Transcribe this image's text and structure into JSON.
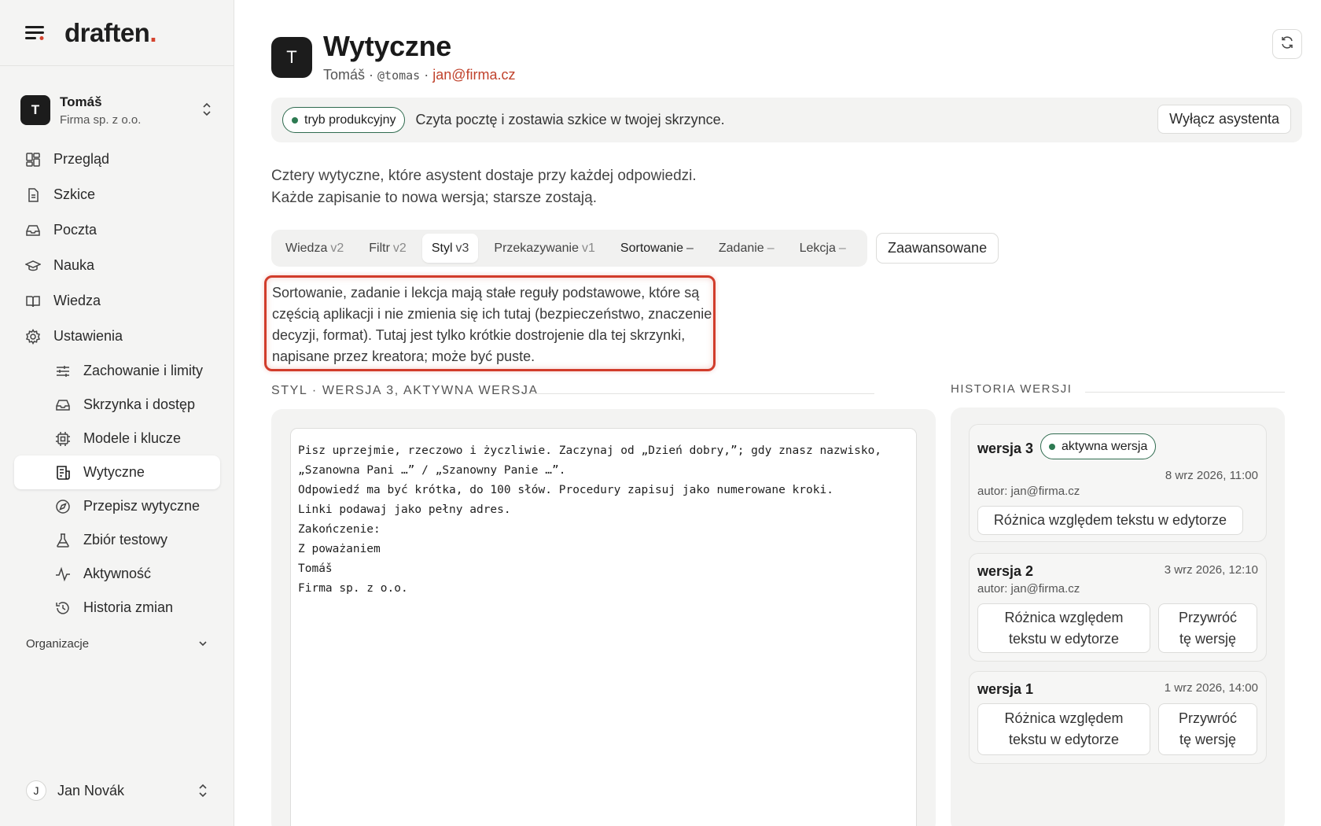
{
  "brand": {
    "logo_text": "draften",
    "logo_dot": "."
  },
  "account": {
    "initial": "T",
    "name": "Tomáš",
    "company": "Firma sp. z o.o."
  },
  "nav": {
    "items": [
      {
        "label": "Przegląd",
        "icon": "dashboard-icon"
      },
      {
        "label": "Szkice",
        "icon": "document-icon"
      },
      {
        "label": "Poczta",
        "icon": "inbox-icon"
      },
      {
        "label": "Nauka",
        "icon": "graduation-cap-icon"
      },
      {
        "label": "Wiedza",
        "icon": "book-icon"
      },
      {
        "label": "Ustawienia",
        "icon": "gear-icon"
      }
    ],
    "sub_items": [
      {
        "label": "Zachowanie i limity",
        "icon": "sliders-icon"
      },
      {
        "label": "Skrzynka i dostęp",
        "icon": "inbox-icon"
      },
      {
        "label": "Modele i klucze",
        "icon": "chip-icon"
      },
      {
        "label": "Wytyczne",
        "icon": "guidelines-icon",
        "active": true
      },
      {
        "label": "Przepisz wytyczne",
        "icon": "compass-icon"
      },
      {
        "label": "Zbiór testowy",
        "icon": "flask-icon"
      },
      {
        "label": "Aktywność",
        "icon": "activity-icon"
      },
      {
        "label": "Historia zmian",
        "icon": "history-icon"
      }
    ],
    "org_label": "Organizacje"
  },
  "user": {
    "initial": "J",
    "name": "Jan Novák"
  },
  "header": {
    "initial": "T",
    "title": "Wytyczne",
    "sub_name": "Tomáš · ",
    "sub_handle": "@tomas",
    "sub_sep": " · ",
    "sub_email": "jan@firma.cz"
  },
  "banner": {
    "badge": "tryb produkcyjny",
    "text": "Czyta pocztę i zostawia szkice w twojej skrzynce.",
    "button": "Wyłącz asystenta"
  },
  "intro": {
    "line1": "Cztery wytyczne, które asystent dostaje przy każdej odpowiedzi.",
    "line2": "Każde zapisanie to nowa wersja; starsze zostają."
  },
  "tabs": [
    {
      "label": "Wiedza",
      "ver": "v2"
    },
    {
      "label": "Filtr",
      "ver": "v2"
    },
    {
      "label": "Styl",
      "ver": "v3",
      "active": true
    },
    {
      "label": "Przekazywanie",
      "ver": "v1"
    },
    {
      "label": "Sortowanie",
      "ver": "–"
    },
    {
      "label": "Zadanie",
      "ver": "–"
    },
    {
      "label": "Lekcja",
      "ver": "–"
    }
  ],
  "advanced_button": "Zaawansowane",
  "note": "Sortowanie, zadanie i lekcja mają stałe reguły podstawowe, które są częścią aplikacji i nie zmienia się ich tutaj (bezpieczeństwo, znaczenie decyzji, format). Tutaj jest tylko krótkie dostrojenie dla tej skrzynki, napisane przez kreatora; może być puste.",
  "section_title": "STYL · WERSJA 3, AKTYWNA WERSJA",
  "history_title": "HISTORIA WERSJI",
  "editor_text": "Pisz uprzejmie, rzeczowo i życzliwie. Zaczynaj od „Dzień dobry,”; gdy znasz nazwisko,\n„Szanowna Pani …” / „Szanowny Panie …”.\nOdpowiedź ma być krótka, do 100 słów. Procedury zapisuj jako numerowane kroki.\nLinki podawaj jako pełny adres.\nZakończenie:\nZ poważaniem\nTomáš\nFirma sp. z o.o.",
  "versions": [
    {
      "name": "wersja 3",
      "badge": "aktywna wersja",
      "date": "8 wrz 2026, 11:00",
      "author": "autor: jan@firma.cz",
      "diff": "Różnica względem tekstu w edytorze"
    },
    {
      "name": "wersja 2",
      "date": "3 wrz 2026, 12:10",
      "author": "autor: jan@firma.cz",
      "diff": "Różnica względem tekstu w edytorze",
      "restore": "Przywróć tę wersję"
    },
    {
      "name": "wersja 1",
      "date": "1 wrz 2026, 14:00",
      "diff": "Różnica względem tekstu w edytorze",
      "restore": "Przywróć tę wersję"
    }
  ],
  "colors": {
    "accent_red": "#d4432e",
    "email_red": "#c0422c",
    "status_green": "#2d7a52",
    "dark": "#1c1c1c"
  }
}
